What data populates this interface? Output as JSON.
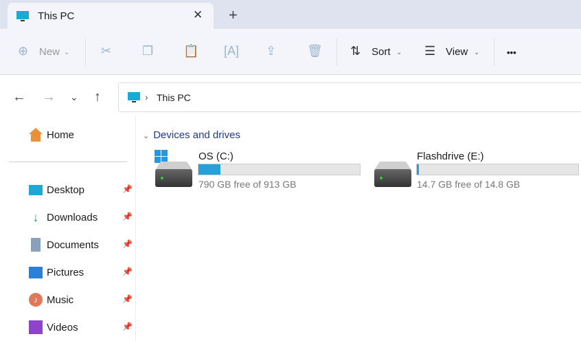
{
  "tab": {
    "title": "This PC",
    "close": "✕",
    "new_tab": "+"
  },
  "toolbar": {
    "new_label": "New",
    "sort_label": "Sort",
    "view_label": "View",
    "more": "•••"
  },
  "address": {
    "path": "This PC"
  },
  "sidebar": {
    "items": [
      {
        "label": "Home"
      },
      {
        "label": "Desktop"
      },
      {
        "label": "Downloads"
      },
      {
        "label": "Documents"
      },
      {
        "label": "Pictures"
      },
      {
        "label": "Music"
      },
      {
        "label": "Videos"
      }
    ]
  },
  "section": {
    "title": "Devices and drives"
  },
  "drives": [
    {
      "name": "OS (C:)",
      "free_text": "790 GB free of 913 GB",
      "used_fraction": 0.135
    },
    {
      "name": "Flashdrive (E:)",
      "free_text": "14.7 GB free of 14.8 GB",
      "used_fraction": 0.007
    }
  ],
  "colors": {
    "accent": "#26a0da",
    "section": "#1e3a8a"
  }
}
